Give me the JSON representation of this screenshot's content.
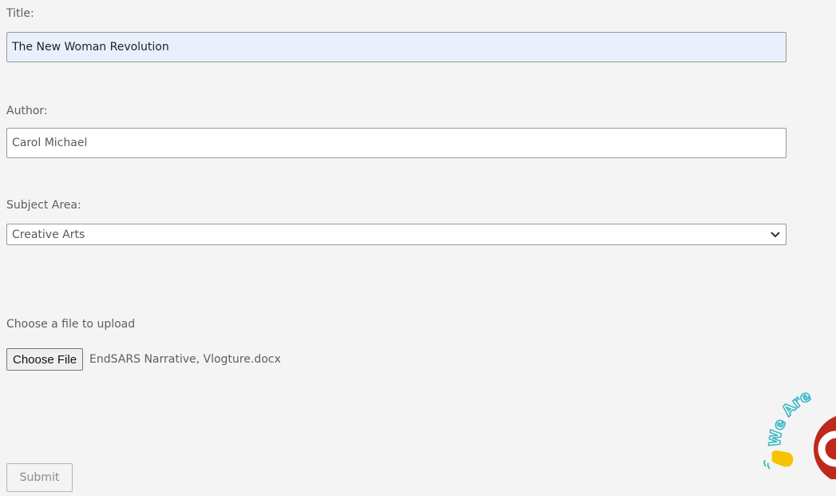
{
  "form": {
    "title_label": "Title:",
    "title_value": "The New Woman Revolution",
    "author_label": "Author:",
    "author_value": "Carol Michael",
    "subject_label": "Subject Area:",
    "subject_value": "Creative Arts",
    "file_label": "Choose a file to upload",
    "file_button": "Choose File",
    "file_name": "EndSARS Narrative, Vlogture.docx",
    "submit_label": "Submit"
  },
  "chat_widget": {
    "banner_text": "We Are",
    "icon": "waving-hand-icon",
    "accent_color": "#c0281c",
    "banner_color": "#3ab7c4"
  }
}
